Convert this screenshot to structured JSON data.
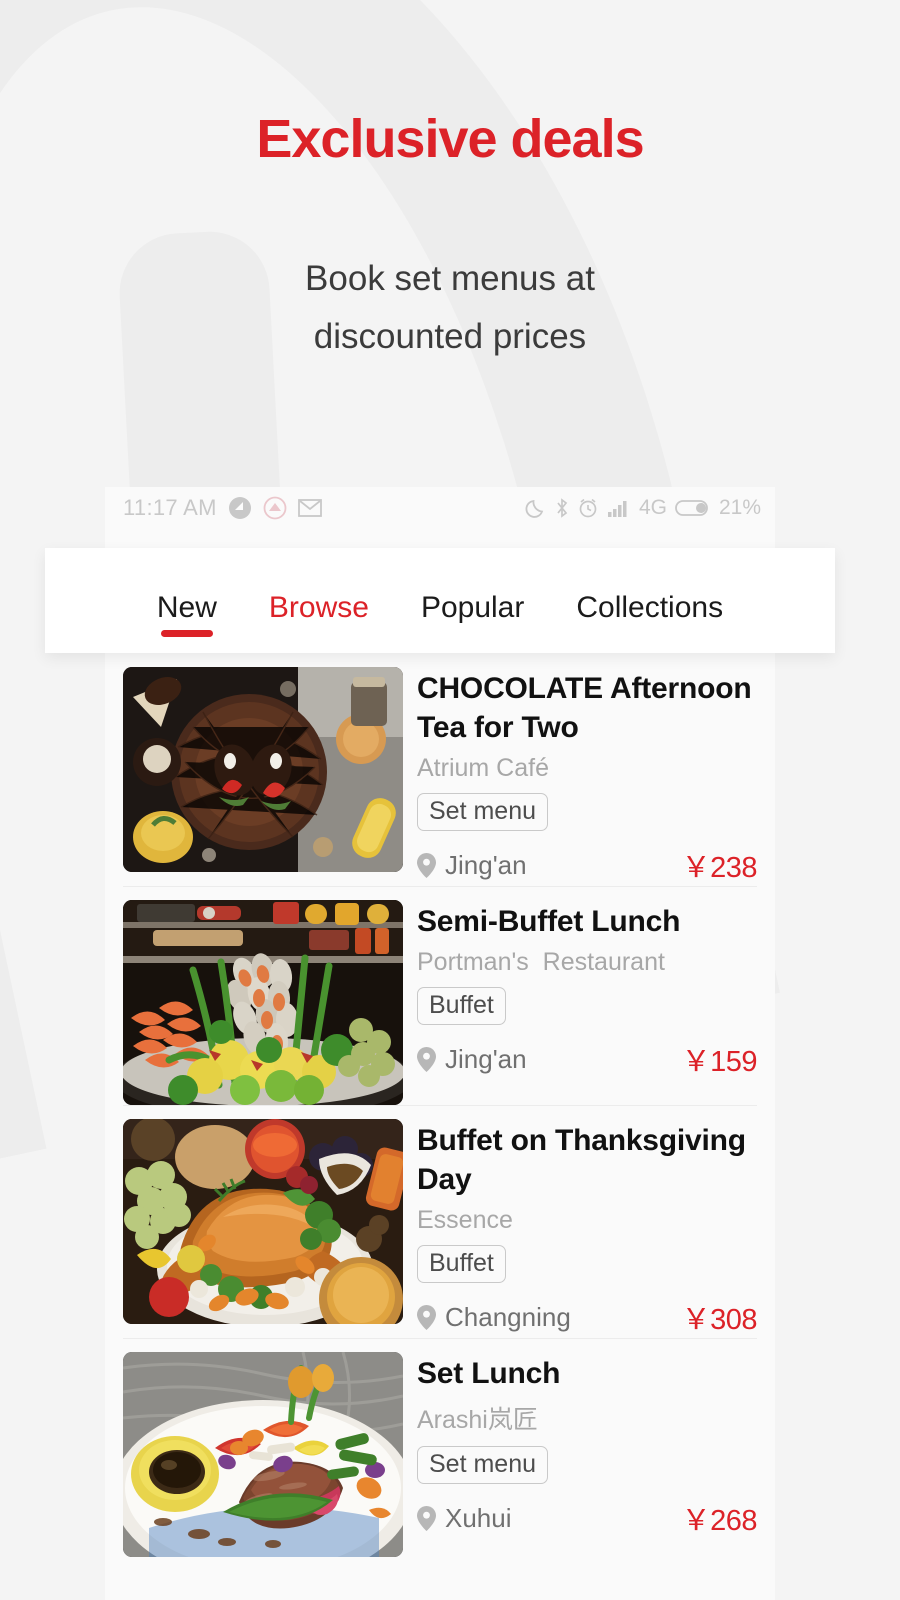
{
  "promo": {
    "headline": "Exclusive deals",
    "subhead_line1": "Book set menus at",
    "subhead_line2": "discounted prices",
    "accent_color": "#dc2228"
  },
  "statusbar": {
    "time": "11:17 AM",
    "network": "4G",
    "battery": "21%",
    "left_icons": [
      "notification-icon",
      "app-badge-icon",
      "gmail-icon"
    ],
    "right_icons": [
      "do-not-disturb-moon-icon",
      "bluetooth-icon",
      "alarm-icon",
      "signal-bars-icon",
      "battery-icon"
    ]
  },
  "tabs": [
    {
      "label": "New",
      "active": true,
      "accent": false
    },
    {
      "label": "Browse",
      "active": false,
      "accent": true
    },
    {
      "label": "Popular",
      "active": false,
      "accent": false
    },
    {
      "label": "Collections",
      "active": false,
      "accent": false
    }
  ],
  "deals": [
    {
      "title": "CHOCOLATE Afternoon Tea for Two",
      "venue": "Atrium Café",
      "tag": "Set menu",
      "location": "Jing'an",
      "price": "￥238",
      "image": "chocolate-sphere-dessert"
    },
    {
      "title": "Semi-Buffet Lunch",
      "venue": "Portman's  Restaurant",
      "tag": "Buffet",
      "location": "Jing'an",
      "price": "￥159",
      "image": "seafood-buffet-spread"
    },
    {
      "title": "Buffet on Thanksgiving Day",
      "venue": "Essence",
      "tag": "Buffet",
      "location": "Changning",
      "price": "￥308",
      "image": "roast-turkey-platter"
    },
    {
      "title": "Set Lunch",
      "venue": "Arashi岚匠",
      "tag": "Set menu",
      "location": "Xuhui",
      "price": "￥268",
      "image": "japanese-beef-plating"
    }
  ]
}
